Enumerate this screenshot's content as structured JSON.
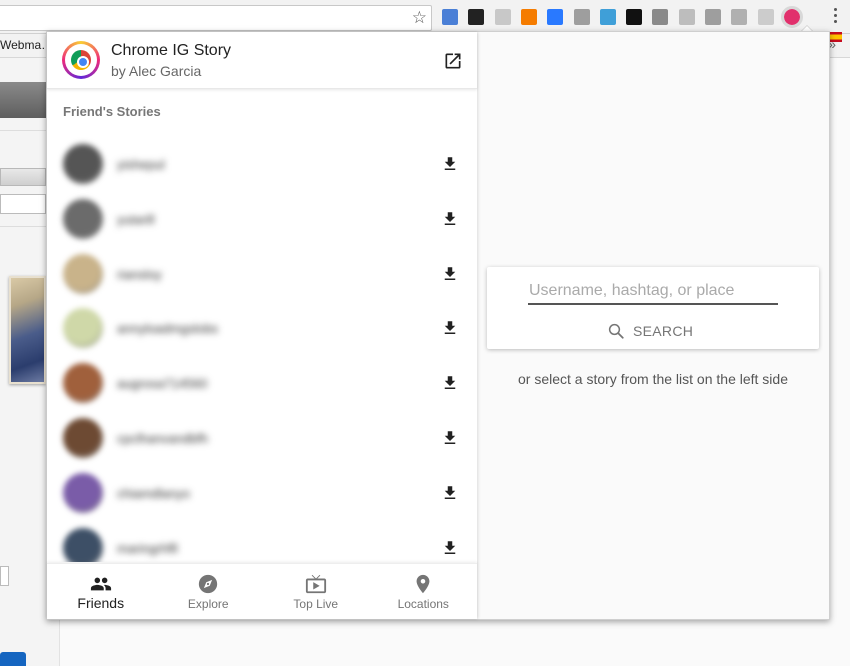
{
  "browser": {
    "bookmark_label": "Webma…",
    "bookmarks_overflow": "»",
    "star_glyph": "☆"
  },
  "extensions": [
    {
      "name": "ext-blue-square-icon",
      "color": "#4a7fd6"
    },
    {
      "name": "ext-dark-circle-icon",
      "color": "#222222"
    },
    {
      "name": "ext-shield-icon",
      "color": "#c8c8c8"
    },
    {
      "name": "ext-orange-chart-icon",
      "color": "#f57c00"
    },
    {
      "name": "ext-blue-e-icon",
      "color": "#2979ff"
    },
    {
      "name": "ext-gear-gray-icon",
      "color": "#9e9e9e"
    },
    {
      "name": "ext-bar-chart-icon",
      "color": "#3f9fd8"
    },
    {
      "name": "ext-black-check-icon",
      "color": "#111111"
    },
    {
      "name": "ext-globe-icon",
      "color": "#8a8a8a"
    },
    {
      "name": "ext-grid-gray-icon",
      "color": "#bdbdbd"
    },
    {
      "name": "ext-m-icon",
      "color": "#9e9e9e"
    },
    {
      "name": "ext-y-icon",
      "color": "#b0b0b0"
    },
    {
      "name": "ext-pen-icon",
      "color": "#cccccc"
    },
    {
      "name": "ext-chrome-ig-story-icon",
      "color": "#e1306c"
    }
  ],
  "app": {
    "title": "Chrome IG Story",
    "author": "by Alec Garcia"
  },
  "friends": {
    "section_title": "Friend's Stories",
    "items": [
      {
        "name": "yishepul",
        "avatar_color": "#555555"
      },
      {
        "name": "yutarill",
        "avatar_color": "#6b6b6b"
      },
      {
        "name": "riansloy",
        "avatar_color": "#c9b38a"
      },
      {
        "name": "annyloadmgslobs",
        "avatar_color": "#cfd8a8"
      },
      {
        "name": "augrosa714560",
        "avatar_color": "#a0603c"
      },
      {
        "name": "cpclhanvandbfh",
        "avatar_color": "#6d4a33"
      },
      {
        "name": "chiamdlanyo",
        "avatar_color": "#7a5ca8"
      },
      {
        "name": "maringrhfll",
        "avatar_color": "#3d4f66"
      }
    ]
  },
  "nav": {
    "friends": "Friends",
    "explore": "Explore",
    "top_live": "Top Live",
    "locations": "Locations"
  },
  "search": {
    "placeholder": "Username, hashtag, or place",
    "button_label": "SEARCH",
    "hint": "or select a story from the list on the left side"
  }
}
